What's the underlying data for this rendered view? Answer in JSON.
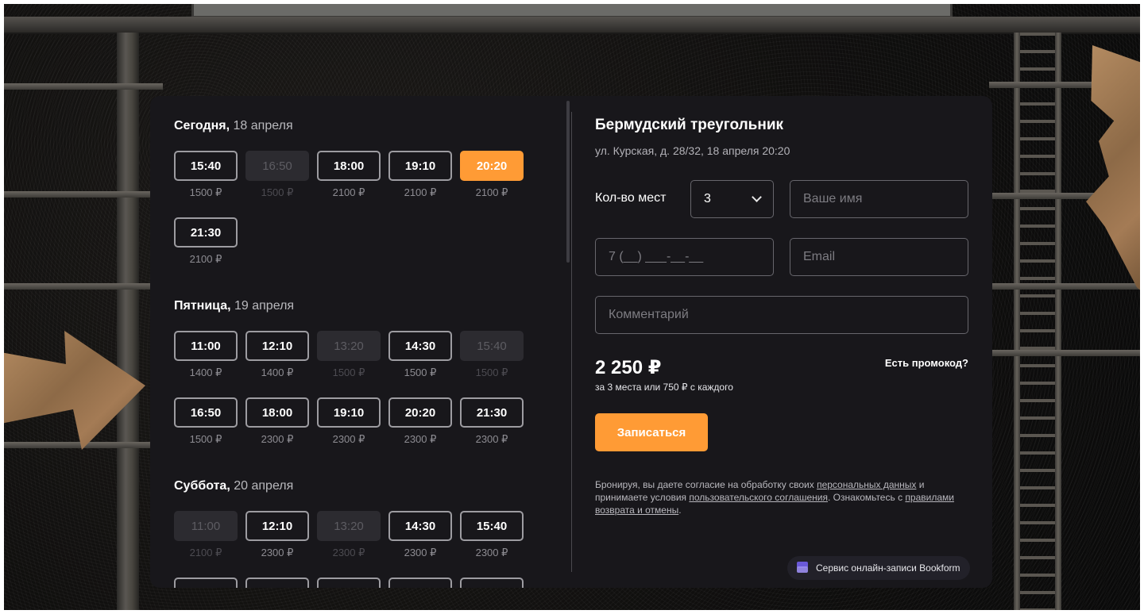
{
  "days": [
    {
      "name": "Сегодня,",
      "date": "18 апреля",
      "slots": [
        {
          "time": "15:40",
          "price": "1500 ₽"
        },
        {
          "time": "16:50",
          "price": "1500 ₽"
        },
        {
          "time": "18:00",
          "price": "2100 ₽"
        },
        {
          "time": "19:10",
          "price": "2100 ₽"
        },
        {
          "time": "20:20",
          "price": "2100 ₽"
        },
        {
          "time": "21:30",
          "price": "2100 ₽"
        }
      ]
    },
    {
      "name": "Пятница,",
      "date": "19 апреля",
      "slots": [
        {
          "time": "11:00",
          "price": "1400 ₽"
        },
        {
          "time": "12:10",
          "price": "1400 ₽"
        },
        {
          "time": "13:20",
          "price": "1500 ₽"
        },
        {
          "time": "14:30",
          "price": "1500 ₽"
        },
        {
          "time": "15:40",
          "price": "1500 ₽"
        },
        {
          "time": "16:50",
          "price": "1500 ₽"
        },
        {
          "time": "18:00",
          "price": "2300 ₽"
        },
        {
          "time": "19:10",
          "price": "2300 ₽"
        },
        {
          "time": "20:20",
          "price": "2300 ₽"
        },
        {
          "time": "21:30",
          "price": "2300 ₽"
        }
      ]
    },
    {
      "name": "Суббота,",
      "date": "20 апреля",
      "slots": [
        {
          "time": "11:00",
          "price": "2100 ₽"
        },
        {
          "time": "12:10",
          "price": "2300 ₽"
        },
        {
          "time": "13:20",
          "price": "2300 ₽"
        },
        {
          "time": "14:30",
          "price": "2300 ₽"
        },
        {
          "time": "15:40",
          "price": "2300 ₽"
        }
      ]
    }
  ],
  "booking": {
    "title": "Бермудский треугольник",
    "subtitle": "ул. Курская, д. 28/32, 18 апреля 20:20",
    "seats_label": "Кол-во мест",
    "seats_value": "3",
    "name_placeholder": "Ваше имя",
    "phone_placeholder": "7 (__) ___-__-__",
    "email_placeholder": "Email",
    "comment_placeholder": "Комментарий",
    "total": "2 250 ₽",
    "total_note": "за 3 места или 750 ₽ с каждого",
    "promo_link": "Есть промокод?",
    "submit_label": "Записаться",
    "consent": {
      "part1": "Бронируя, вы даете согласие на обработку своих ",
      "link1": "персональных данных",
      "part2": " и принимаете условия ",
      "link2": "пользовательского соглашения",
      "part3": ". Ознакомьтесь с ",
      "link3": "правилами возврата и отмены",
      "part4": "."
    },
    "powered_by": "Сервис онлайн-записи Bookform"
  },
  "colors": {
    "accent": "#ff9b35",
    "panel": "#18171b",
    "disabled_slot": "#2c2b30"
  }
}
